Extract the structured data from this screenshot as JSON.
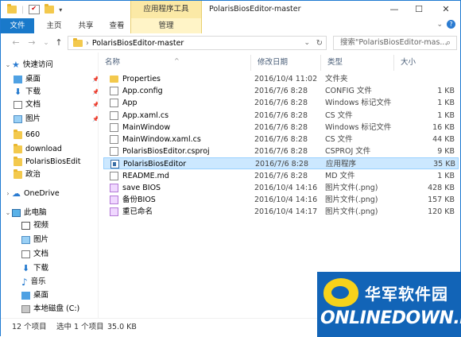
{
  "window": {
    "title": "PolarisBiosEditor-master",
    "context_tab": "应用程序工具",
    "controls": {
      "minimize": "—",
      "maximize": "☐",
      "close": "✕"
    }
  },
  "ribbon": {
    "tabs": [
      "文件",
      "主页",
      "共享",
      "查看",
      "管理"
    ]
  },
  "nav": {
    "back": "←",
    "forward": "→",
    "down": "⌄",
    "up": "↑",
    "address": "PolarisBiosEditor-master",
    "address_chevron_left": "›",
    "address_dropdown": "⌄",
    "refresh": "↻",
    "search_placeholder": "搜索\"PolarisBiosEditor-mas...",
    "search_icon": "⌕"
  },
  "sidebar": {
    "quick_access": "快速访问",
    "items": [
      {
        "label": "桌面",
        "icon": "desktop-icon",
        "pinned": true
      },
      {
        "label": "下载",
        "icon": "download-icon",
        "pinned": true
      },
      {
        "label": "文档",
        "icon": "document-icon",
        "pinned": true
      },
      {
        "label": "图片",
        "icon": "picture-icon",
        "pinned": true
      },
      {
        "label": "660",
        "icon": "folder-icon",
        "pinned": false
      },
      {
        "label": "download",
        "icon": "folder-icon",
        "pinned": false
      },
      {
        "label": "PolarisBiosEdit",
        "icon": "folder-icon",
        "pinned": false
      },
      {
        "label": "政治",
        "icon": "folder-icon",
        "pinned": false
      }
    ],
    "onedrive": "OneDrive",
    "this_pc": "此电脑",
    "pc_items": [
      {
        "label": "视频",
        "icon": "video-icon"
      },
      {
        "label": "图片",
        "icon": "picture-icon"
      },
      {
        "label": "文档",
        "icon": "document-icon"
      },
      {
        "label": "下载",
        "icon": "download-icon"
      },
      {
        "label": "音乐",
        "icon": "music-icon"
      },
      {
        "label": "桌面",
        "icon": "desktop-icon"
      },
      {
        "label": "本地磁盘 (C:)",
        "icon": "disk-icon"
      }
    ],
    "pin_glyph": "📌"
  },
  "columns": {
    "name": "名称",
    "date": "修改日期",
    "type": "类型",
    "size": "大小",
    "sort_glyph": "^"
  },
  "files": [
    {
      "name": "Properties",
      "date": "2016/10/4 11:02",
      "type": "文件夹",
      "size": "",
      "icon": "folder"
    },
    {
      "name": "App.config",
      "date": "2016/7/6 8:28",
      "type": "CONFIG 文件",
      "size": "1 KB",
      "icon": "config"
    },
    {
      "name": "App",
      "date": "2016/7/6 8:28",
      "type": "Windows 标记文件",
      "size": "1 KB",
      "icon": "cs"
    },
    {
      "name": "App.xaml.cs",
      "date": "2016/7/6 8:28",
      "type": "CS 文件",
      "size": "1 KB",
      "icon": "cs"
    },
    {
      "name": "MainWindow",
      "date": "2016/7/6 8:28",
      "type": "Windows 标记文件",
      "size": "16 KB",
      "icon": "cs"
    },
    {
      "name": "MainWindow.xaml.cs",
      "date": "2016/7/6 8:28",
      "type": "CS 文件",
      "size": "44 KB",
      "icon": "cs"
    },
    {
      "name": "PolarisBiosEditor.csproj",
      "date": "2016/7/6 8:28",
      "type": "CSPROJ 文件",
      "size": "9 KB",
      "icon": "config"
    },
    {
      "name": "PolarisBiosEditor",
      "date": "2016/7/6 8:28",
      "type": "应用程序",
      "size": "35 KB",
      "icon": "exe",
      "selected": true
    },
    {
      "name": "README.md",
      "date": "2016/7/6 8:28",
      "type": "MD 文件",
      "size": "1 KB",
      "icon": "md"
    },
    {
      "name": "save BIOS",
      "date": "2016/10/4 14:16",
      "type": "图片文件(.png)",
      "size": "428 KB",
      "icon": "png"
    },
    {
      "name": "备份BIOS",
      "date": "2016/10/4 14:16",
      "type": "图片文件(.png)",
      "size": "157 KB",
      "icon": "png"
    },
    {
      "name": "重已命名",
      "date": "2016/10/4 14:17",
      "type": "图片文件(.png)",
      "size": "120 KB",
      "icon": "png"
    }
  ],
  "status": {
    "count": "12 个项目",
    "selected": "选中 1 个项目",
    "size": "35.0 KB"
  },
  "watermark": {
    "cn": "华军软件园",
    "en": "ONLINEDOWN.NET"
  },
  "colors": {
    "accent": "#1979ca",
    "selection": "#cce8ff",
    "context": "#fbe9a6"
  }
}
